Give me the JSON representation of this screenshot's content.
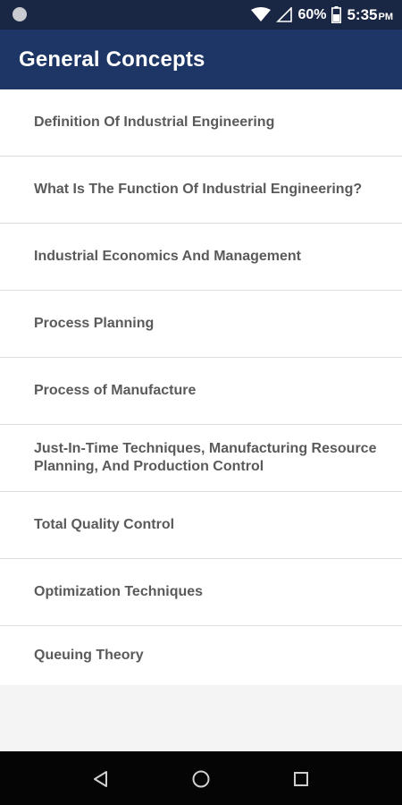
{
  "status_bar": {
    "battery_percent": "60%",
    "time": "5:35",
    "meridiem": "PM",
    "icons": [
      "notification-dot-icon",
      "wifi-icon",
      "signal-icon",
      "battery-icon"
    ]
  },
  "app_bar": {
    "title": "General Concepts",
    "color": "#1e3666"
  },
  "list": {
    "items": [
      {
        "label": "Definition Of Industrial Engineering"
      },
      {
        "label": "What Is The Function Of Industrial Engineering?"
      },
      {
        "label": "Industrial Economics And Management"
      },
      {
        "label": "Process Planning"
      },
      {
        "label": "Process of Manufacture"
      },
      {
        "label": "Just-In-Time Techniques, Manufacturing Resource Planning, And Production Control"
      },
      {
        "label": "Total Quality Control"
      },
      {
        "label": "Optimization Techniques"
      },
      {
        "label": "Queuing Theory"
      }
    ]
  },
  "nav_bar": {
    "buttons": [
      "back-icon",
      "home-icon",
      "recents-icon"
    ]
  }
}
